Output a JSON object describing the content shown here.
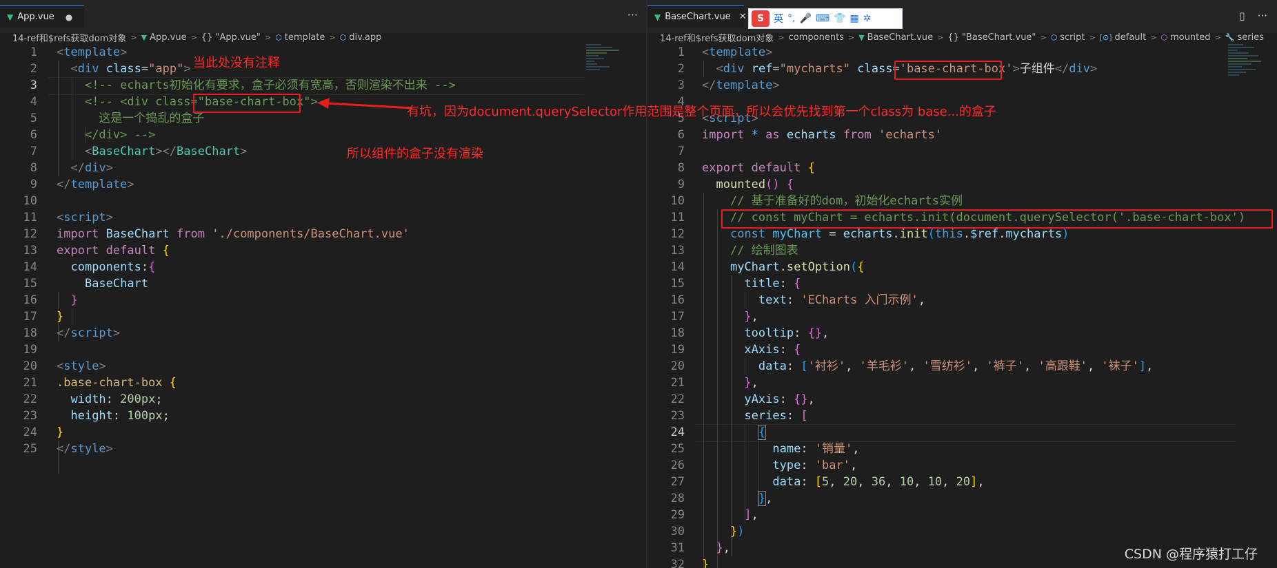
{
  "left": {
    "tab": {
      "label": "App.vue"
    },
    "breadcrumb": [
      "14-ref和$refs获取dom对象",
      "App.vue",
      "{} \"App.vue\"",
      "template",
      "div.app"
    ],
    "line_numbers": [
      "1",
      "2",
      "3",
      "4",
      "5",
      "6",
      "7",
      "8",
      "9",
      "10",
      "11",
      "12",
      "13",
      "14",
      "15",
      "16",
      "17",
      "18",
      "19",
      "20",
      "21",
      "22",
      "23",
      "24",
      "25"
    ],
    "notes": {
      "no_comment": "当此处没有注释",
      "pitfall": "有坑，因为document.querySelector作用范围是整个页面，所以会优先找到第一个class为 base...的盒子",
      "not_rendered": "所以组件的盒子没有渲染"
    },
    "code": {
      "l2_class": "\"app\"",
      "l3_comment": "<!-- echarts初始化有要求，盒子必须有宽高，否则渲染不出来 -->",
      "l4_pre": "<!-- <div class=",
      "l4_box": "\"base-chart-box\"",
      "l4_post": ">",
      "l5_comment": "这是一个捣乱的盒子",
      "l6_comment": "</div> -->",
      "l12_path": "'./components/BaseChart.vue'",
      "l21_selector": ".base-chart-box",
      "l22_value": "200px",
      "l23_value": "100px"
    }
  },
  "right": {
    "tab": {
      "label": "BaseChart.vue"
    },
    "breadcrumb": [
      "14-ref和$refs获取dom对象",
      "components",
      "BaseChart.vue",
      "{} \"BaseChart.vue\"",
      "script",
      "default",
      "mounted",
      "series"
    ],
    "line_numbers": [
      "1",
      "2",
      "3",
      "4",
      "5",
      "6",
      "7",
      "8",
      "9",
      "10",
      "11",
      "12",
      "13",
      "14",
      "15",
      "16",
      "17",
      "18",
      "19",
      "20",
      "21",
      "22",
      "23",
      "24",
      "25",
      "26",
      "27",
      "28",
      "29",
      "30",
      "31",
      "32"
    ],
    "current_line": "24",
    "code": {
      "l2_ref": "\"mycharts\"",
      "l2_class": "'base-chart-box'",
      "l2_text": "子组件",
      "l6_module": "'echarts'",
      "l10_comment": "// 基于准备好的dom，初始化echarts实例",
      "l11_comment": "// const myChart = echarts.init(document.querySelector('.base-chart-box')",
      "l13_comment": "// 绘制图表",
      "l16_text": "'ECharts 入门示例'",
      "l20_items": [
        "'衬衫'",
        "'羊毛衫'",
        "'雪纺衫'",
        "'裤子'",
        "'高跟鞋'",
        "'袜子'"
      ],
      "l25_name": "'销量'",
      "l26_type": "'bar'",
      "l27_data": [
        "5",
        "20",
        "36",
        "10",
        "10",
        "20"
      ]
    }
  },
  "ime": {
    "lang": "英",
    "punct": "°,"
  },
  "watermark": "CSDN @程序猿打工仔",
  "colors": {
    "annotation_red": "#e81e1e",
    "tab_accent": "#3794ff",
    "editor_bg": "#1e1e1e"
  }
}
